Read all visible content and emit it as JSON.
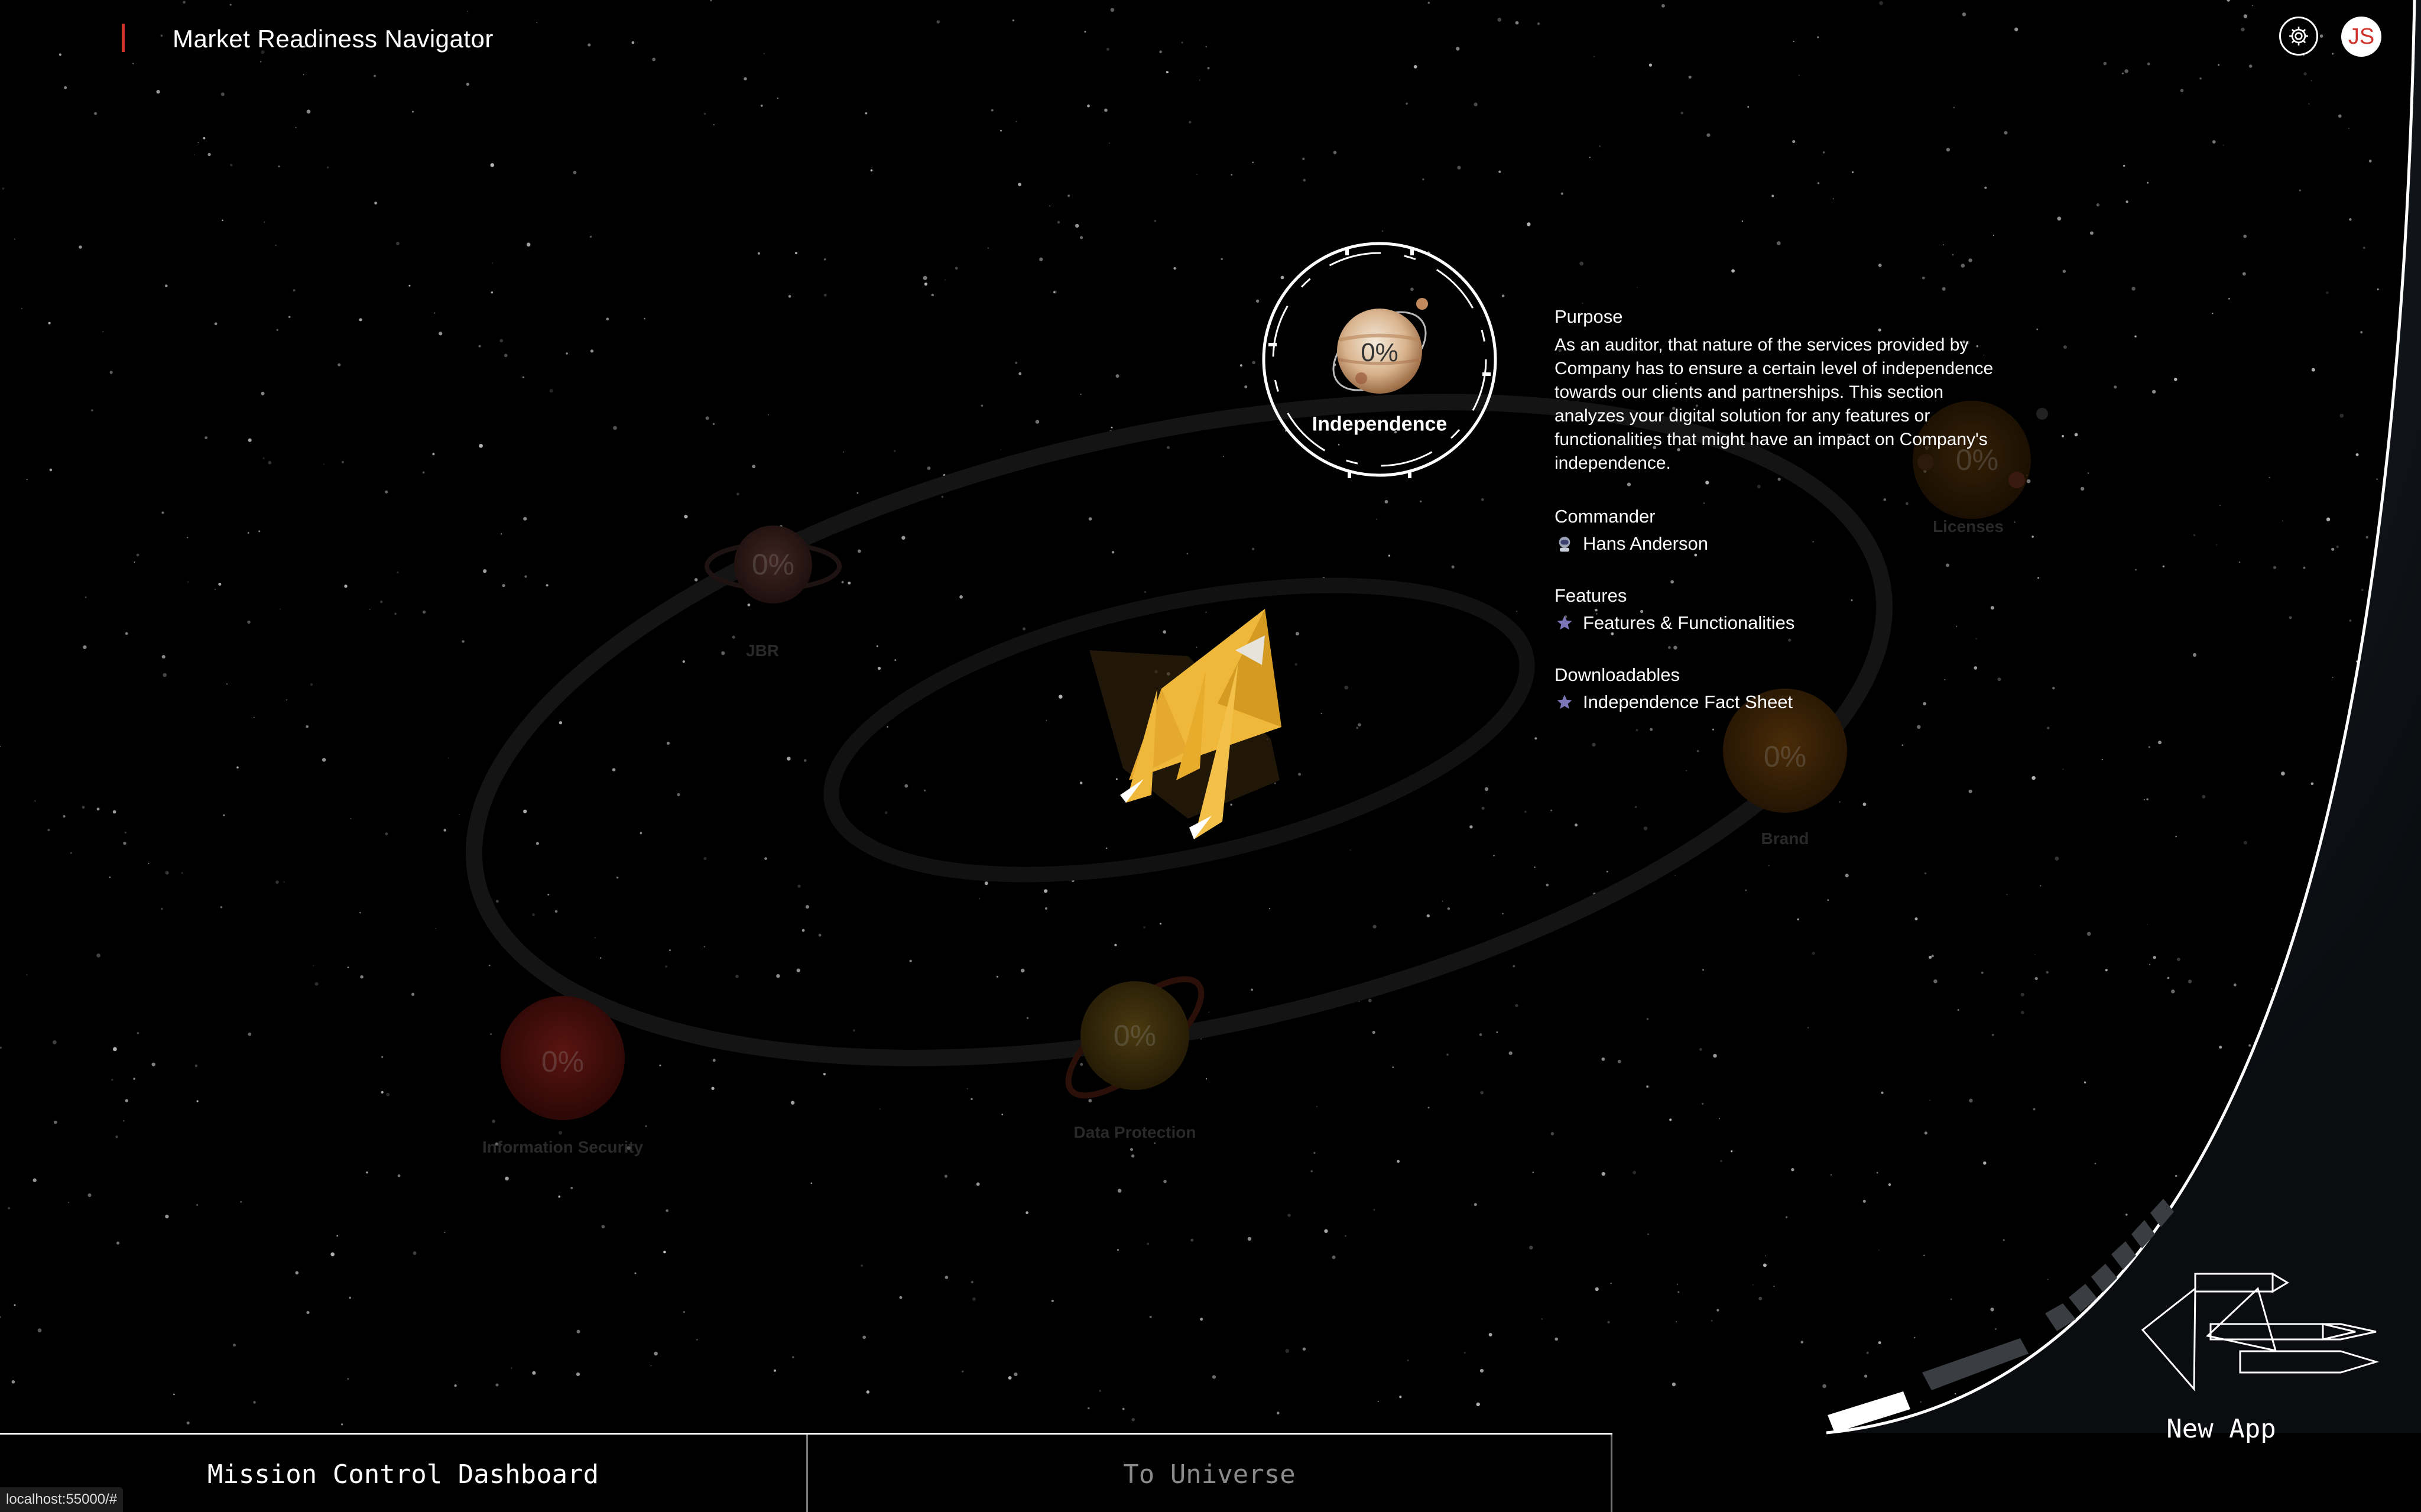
{
  "header": {
    "title": "Market Readiness Navigator",
    "user_initials": "JS"
  },
  "planets": [
    {
      "name": "JBR",
      "progress": "0%"
    },
    {
      "name": "Licenses",
      "progress": "0%"
    },
    {
      "name": "Brand",
      "progress": "0%"
    },
    {
      "name": "Information Security",
      "progress": "0%"
    },
    {
      "name": "Data Protection",
      "progress": "0%"
    }
  ],
  "selected": {
    "name": "Independence",
    "progress": "0%"
  },
  "info": {
    "purpose_heading": "Purpose",
    "purpose_text": "As an auditor, that nature of the services provided by Company has to ensure a certain level of independence towards our clients and partnerships. This section analyzes your digital solution for any features or functionalities that might have an impact on Company's independence.",
    "commander_heading": "Commander",
    "commander_name": "Hans Anderson",
    "features_heading": "Features",
    "features_item": "Features & Functionalities",
    "downloadables_heading": "Downloadables",
    "downloadables_item": "Independence Fact Sheet"
  },
  "bottom_bar": {
    "mission_control": "Mission Control Dashboard",
    "to_universe": "To Universe",
    "new_app": "New App"
  },
  "status_bar": {
    "url": "localhost:55000/#"
  },
  "colors": {
    "accent": "#d0342c",
    "rocket": "#f0b83a",
    "background": "#000000"
  }
}
